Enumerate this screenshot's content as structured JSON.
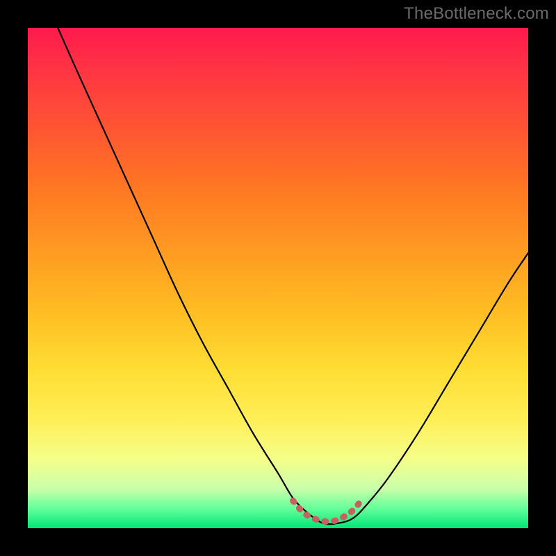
{
  "watermark": "TheBottleneck.com",
  "chart_data": {
    "type": "line",
    "title": "",
    "xlabel": "",
    "ylabel": "",
    "xlim": [
      0,
      100
    ],
    "ylim": [
      0,
      100
    ],
    "grid": false,
    "background_gradient": {
      "stops": [
        {
          "pct": 0,
          "color": "#ff1a4d"
        },
        {
          "pct": 20,
          "color": "#ff5533"
        },
        {
          "pct": 44,
          "color": "#ff9922"
        },
        {
          "pct": 68,
          "color": "#ffdd33"
        },
        {
          "pct": 86,
          "color": "#f5ff88"
        },
        {
          "pct": 96,
          "color": "#66ff99"
        },
        {
          "pct": 100,
          "color": "#00e676"
        }
      ]
    },
    "series": [
      {
        "name": "bottleneck-curve",
        "color": "#000000",
        "x": [
          6,
          10,
          15,
          20,
          25,
          30,
          35,
          40,
          45,
          50,
          53,
          56,
          59,
          62,
          65,
          68,
          72,
          78,
          84,
          90,
          96,
          100
        ],
        "y": [
          100,
          91,
          80,
          69,
          58,
          47,
          37,
          28,
          19,
          11,
          6,
          3,
          1,
          1,
          2,
          5,
          10,
          19,
          29,
          39,
          49,
          55
        ]
      },
      {
        "name": "optimal-zone-marker",
        "color": "#cc6666",
        "style": "dotted-thick",
        "x": [
          53,
          55,
          57,
          59,
          61,
          63,
          65,
          67
        ],
        "y": [
          5.5,
          3.2,
          2.0,
          1.4,
          1.4,
          2.2,
          3.6,
          6.0
        ]
      }
    ],
    "annotations": []
  }
}
